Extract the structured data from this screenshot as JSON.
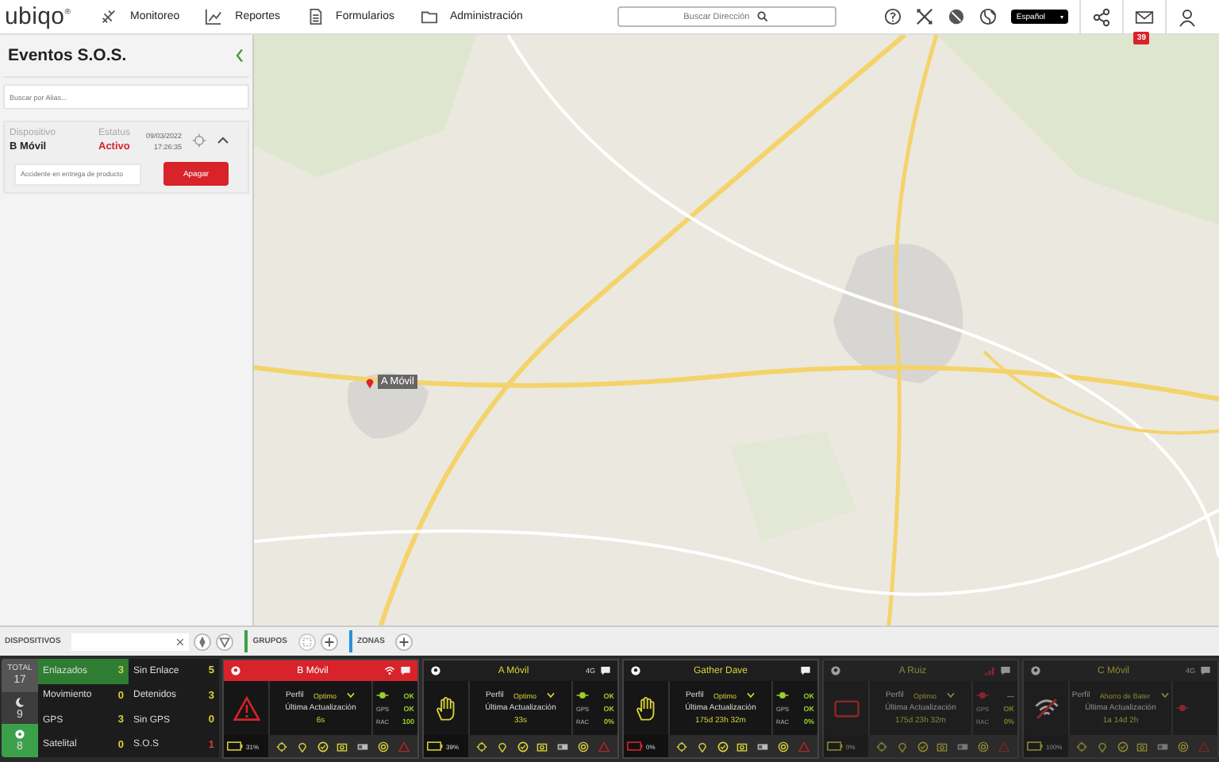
{
  "header": {
    "logo": "ubiqo",
    "logo_mark": "®",
    "nav": [
      {
        "kind": "monitor",
        "label": "Monitoreo"
      },
      {
        "kind": "reports",
        "label": "Reportes"
      },
      {
        "kind": "forms",
        "label": "Formularios"
      },
      {
        "kind": "admin",
        "label": "Administración"
      }
    ],
    "search": {
      "placeholder": "Buscar Dirección"
    },
    "language": "Español",
    "notifications": "39"
  },
  "sos_panel": {
    "title": "Eventos S.O.S.",
    "search": {
      "placeholder": "Buscar por Alias..."
    },
    "events": [
      {
        "device_label": "Dispositivo",
        "device": "B Móvil",
        "status_label": "Estatus",
        "status": "Activo",
        "date": "09/03/2022",
        "time": "17:26:35",
        "expanded": true,
        "note": {
          "placeholder": "Accidente en entrega de producto"
        },
        "button": "Apagar"
      }
    ]
  },
  "map": {
    "kind": "picture",
    "markers": [
      {
        "label": "A Móvil"
      }
    ]
  },
  "toolbar": {
    "devices_label": "DISPOSITIVOS",
    "groups_label": "GRUPOS",
    "zones_label": "ZONAS"
  },
  "stats": {
    "tiles": [
      {
        "kind": "total",
        "label": "TOTAL",
        "count": "17"
      },
      {
        "kind": "night",
        "count": "9"
      },
      {
        "kind": "online",
        "count": "8"
      }
    ],
    "filters": [
      {
        "label": "Enlazados",
        "count": "3",
        "selected": true,
        "color": "#d8d23a"
      },
      {
        "label": "Sin Enlace",
        "count": "5",
        "selected": false,
        "color": "#d8d23a"
      },
      {
        "label": "Movimiento",
        "count": "0",
        "selected": false,
        "color": "#d8d23a"
      },
      {
        "label": "Detenidos",
        "count": "3",
        "selected": false,
        "color": "#d8d23a"
      },
      {
        "label": "GPS",
        "count": "3",
        "selected": false,
        "color": "#d8d23a"
      },
      {
        "label": "Sin GPS",
        "count": "0",
        "selected": false,
        "color": "#d8d23a"
      },
      {
        "label": "Satelital",
        "count": "0",
        "selected": false,
        "color": "#d8d23a"
      },
      {
        "label": "S.O.S",
        "count": "1",
        "selected": false,
        "color": "#e03a2f"
      }
    ]
  },
  "devices": [
    {
      "name": "B Móvil",
      "alert": true,
      "online": true,
      "signal": {
        "kind": "wifi"
      },
      "kind": "sos",
      "perfil_label": "Perfil",
      "perfil": "Optimo",
      "update_label": "Última Actualización",
      "update": "6s",
      "link_ok": true,
      "link": "OK",
      "gps_label": "GPS",
      "gps": "OK",
      "rac_label": "RAC",
      "rac": "100",
      "battery": "31%",
      "battery_low": false
    },
    {
      "name": "A Móvil",
      "alert": false,
      "online": true,
      "network": "4G",
      "kind": "stopped",
      "perfil_label": "Perfil",
      "perfil": "Optimo",
      "update_label": "Última Actualización",
      "update": "33s",
      "link_ok": true,
      "link": "OK",
      "gps_label": "GPS",
      "gps": "OK",
      "rac_label": "RAC",
      "rac": "0%",
      "battery": "39%",
      "battery_low": false
    },
    {
      "name": "Gather Dave",
      "alert": false,
      "online": true,
      "kind": "stopped",
      "perfil_label": "Perfil",
      "perfil": "Optimo",
      "update_label": "Última Actualización",
      "update": "175d 23h 32m",
      "link_ok": true,
      "link": "OK",
      "gps_label": "GPS",
      "gps": "OK",
      "rac_label": "RAC",
      "rac": "0%",
      "battery": "0%",
      "battery_low": true
    },
    {
      "name": "A Ruiz",
      "alert": false,
      "online": false,
      "signal": {
        "kind": "bars"
      },
      "kind": "inactive",
      "perfil_label": "Perfil",
      "perfil": "Optimo",
      "update_label": "Última Actualización",
      "update": "175d 23h 32m",
      "link_ok": false,
      "link": "---",
      "gps_label": "GPS",
      "gps": "OK",
      "rac_label": "RAC",
      "rac": "0%",
      "battery": "0%",
      "battery_low": false
    },
    {
      "name": "C Móvil",
      "alert": false,
      "online": false,
      "network": "4G",
      "kind": "nosignal",
      "perfil_label": "Perfil",
      "perfil": "Ahorro de Bater",
      "update_label": "Última Actualización",
      "update": "1a 14d 2h",
      "link_ok": false,
      "battery": "100%",
      "battery_low": false
    }
  ]
}
